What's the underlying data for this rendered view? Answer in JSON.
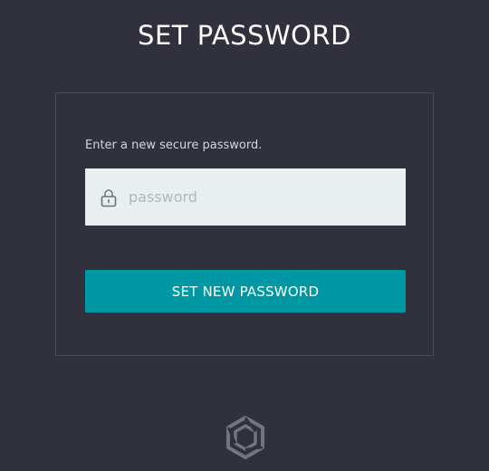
{
  "page": {
    "title": "SET PASSWORD"
  },
  "form": {
    "instructions": "Enter a new secure password.",
    "password_placeholder": "password",
    "password_value": "",
    "submit_label": "SET NEW PASSWORD"
  },
  "icons": {
    "field_icon": "lock-icon",
    "footer_logo": "brand-logo"
  },
  "colors": {
    "background": "#30313d",
    "accent": "#0097a4",
    "field_background": "#e9eeef",
    "panel_border": "#4a4b57"
  }
}
